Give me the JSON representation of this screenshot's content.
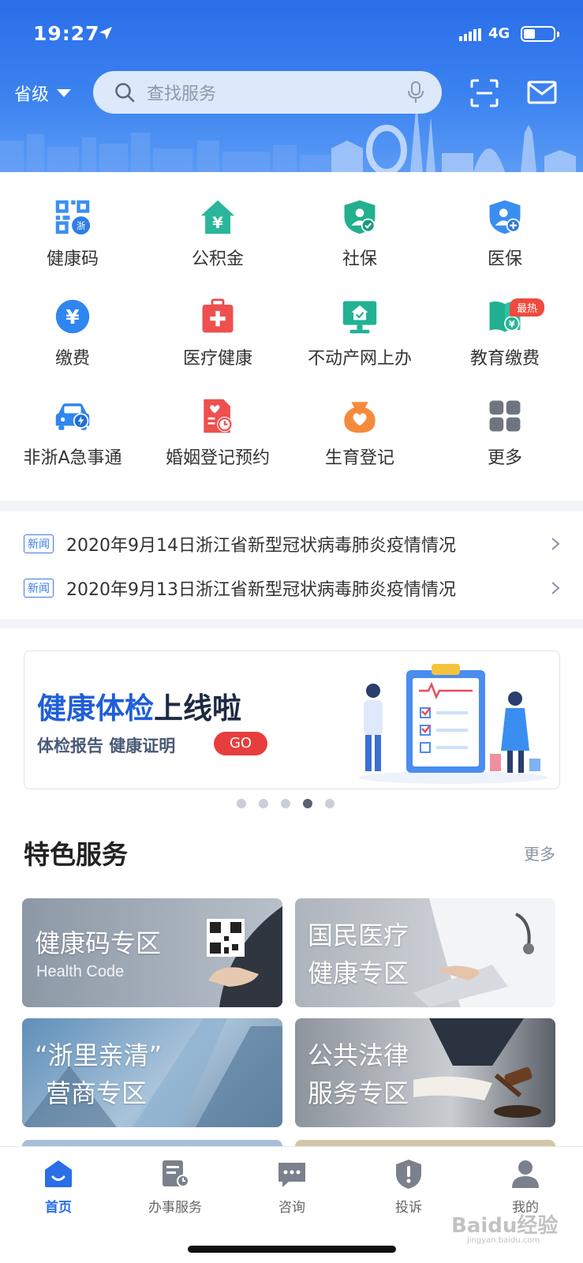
{
  "status_bar": {
    "time": "19:27",
    "network": "4G"
  },
  "header": {
    "region_label": "省级",
    "search_placeholder": "查找服务"
  },
  "quick_services": [
    {
      "label": "健康码",
      "icon": "health-code-icon"
    },
    {
      "label": "公积金",
      "icon": "housing-fund-icon"
    },
    {
      "label": "社保",
      "icon": "social-security-icon"
    },
    {
      "label": "医保",
      "icon": "medical-insurance-icon"
    },
    {
      "label": "缴费",
      "icon": "payment-icon"
    },
    {
      "label": "医疗健康",
      "icon": "medical-kit-icon"
    },
    {
      "label": "不动产网上办",
      "icon": "real-estate-icon"
    },
    {
      "label": "教育缴费",
      "icon": "education-payment-icon",
      "badge": "最热"
    },
    {
      "label": "非浙A急事通",
      "icon": "car-icon"
    },
    {
      "label": "婚姻登记预约",
      "icon": "marriage-registration-icon"
    },
    {
      "label": "生育登记",
      "icon": "birth-registration-icon"
    },
    {
      "label": "更多",
      "icon": "more-grid-icon"
    }
  ],
  "news": [
    {
      "tag": "新闻",
      "title": "2020年9月14日浙江省新型冠状病毒肺炎疫情情况"
    },
    {
      "tag": "新闻",
      "title": "2020年9月13日浙江省新型冠状病毒肺炎疫情情况"
    }
  ],
  "banner": {
    "title_highlight": "健康体检",
    "title_rest": "上线啦",
    "subtitle": "体检报告  健康证明",
    "go_label": "GO",
    "carousel_active": 4,
    "carousel_count": 5
  },
  "featured": {
    "title": "特色服务",
    "more_label": "更多",
    "cards": [
      {
        "line1": "健康码专区",
        "line2": "Health Code"
      },
      {
        "line1": "国民医疗",
        "line2": "健康专区"
      },
      {
        "line1": "“浙里亲清”",
        "line2": "营商专区"
      },
      {
        "line1": "公共法律",
        "line2": "服务专区"
      }
    ]
  },
  "tabbar": [
    {
      "label": "首页",
      "icon": "home-icon",
      "active": true
    },
    {
      "label": "办事服务",
      "icon": "service-doc-icon",
      "active": false
    },
    {
      "label": "咨询",
      "icon": "chat-icon",
      "active": false
    },
    {
      "label": "投诉",
      "icon": "complaint-shield-icon",
      "active": false
    },
    {
      "label": "我的",
      "icon": "profile-icon",
      "active": false
    }
  ],
  "watermark": {
    "text": "Baidu经验",
    "sub": "jingyan.baidu.com"
  },
  "colors": {
    "brand_blue": "#2a6ee8",
    "hot_red": "#f04a3e",
    "go_red": "#e83d3d"
  }
}
